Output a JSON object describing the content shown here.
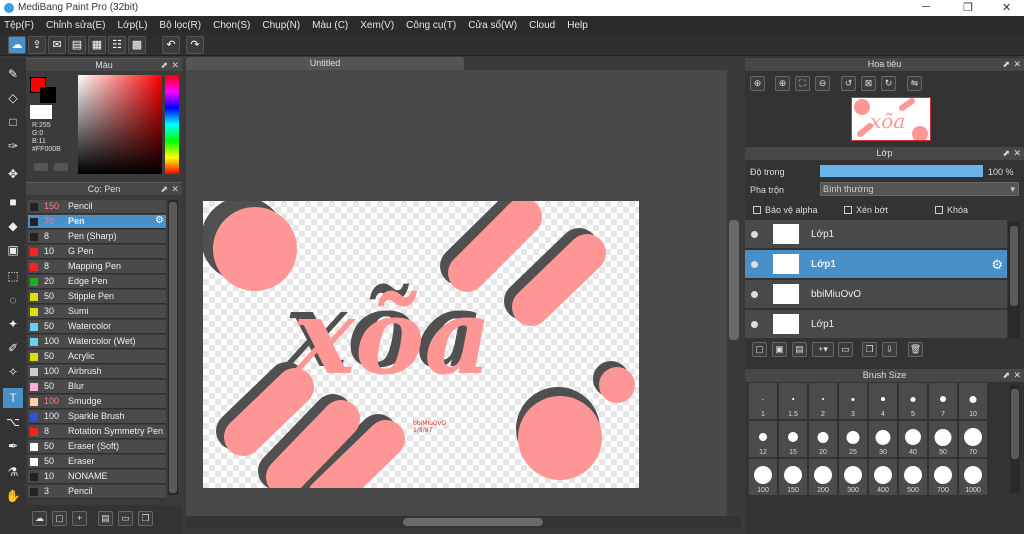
{
  "window": {
    "title": "MediBang Paint Pro (32bit)",
    "min": "─",
    "restore": "❐",
    "close": "✕"
  },
  "menu": [
    "Tệp(F)",
    "Chỉnh sửa(E)",
    "Lớp(L)",
    "Bộ lọc(R)",
    "Chọn(S)",
    "Chụp(N)",
    "Màu (C)",
    "Xem(V)",
    "Công cụ(T)",
    "Cửa sổ(W)",
    "Cloud",
    "Help"
  ],
  "panels": {
    "color": "Màu",
    "brush": "Cọ: Pen",
    "navigator": "Hoa tiêu",
    "layer": "Lớp",
    "brushsize": "Brush Size"
  },
  "color": {
    "r": "R:255",
    "g": "G:0",
    "b": "B:11",
    "hex": "#FF000B",
    "fg": "#ff0000",
    "bg": "#000000"
  },
  "document": {
    "tab": "Untitled"
  },
  "brushes": [
    {
      "size": "150",
      "name": "Pencil",
      "color": "#222222"
    },
    {
      "size": "70",
      "name": "Pen",
      "color": "#222222",
      "selected": true
    },
    {
      "size": "8",
      "name": "Pen (Sharp)",
      "color": "#222222"
    },
    {
      "size": "10",
      "name": "G Pen",
      "color": "#ff2020"
    },
    {
      "size": "8",
      "name": "Mapping Pen",
      "color": "#ff2020"
    },
    {
      "size": "20",
      "name": "Edge Pen",
      "color": "#22aa22"
    },
    {
      "size": "50",
      "name": "Stipple Pen",
      "color": "#e0e000"
    },
    {
      "size": "30",
      "name": "Sumi",
      "color": "#e0e000"
    },
    {
      "size": "50",
      "name": "Watercolor",
      "color": "#6ad0f0"
    },
    {
      "size": "100",
      "name": "Watercolor (Wet)",
      "color": "#6ad0f0"
    },
    {
      "size": "50",
      "name": "Acrylic",
      "color": "#e0e000"
    },
    {
      "size": "100",
      "name": "Airbrush",
      "color": "#cccccc"
    },
    {
      "size": "50",
      "name": "Blur",
      "color": "#ffb0d0"
    },
    {
      "size": "100",
      "name": "Smudge",
      "color": "#ffd0a8"
    },
    {
      "size": "100",
      "name": "Sparkle Brush",
      "color": "#3050e0"
    },
    {
      "size": "8",
      "name": "Rotation Symmetry Pen",
      "color": "#ff2020"
    },
    {
      "size": "50",
      "name": "Eraser (Soft)",
      "color": "#ffffff"
    },
    {
      "size": "50",
      "name": "Eraser",
      "color": "#ffffff"
    },
    {
      "size": "10",
      "name": "NONAME",
      "color": "#222222"
    },
    {
      "size": "3",
      "name": "Pencil",
      "color": "#222222"
    }
  ],
  "layer": {
    "opacity_label": "Độ trong",
    "opacity_value": "100 %",
    "opacity_fraction": 1.0,
    "blend_label": "Pha trộn",
    "blend_value": "Bình thường",
    "protect_alpha": "Bảo vệ alpha",
    "clipping": "Xén bớt",
    "lock": "Khóa"
  },
  "layers": [
    {
      "name": "Lớp1"
    },
    {
      "name": "Lớp1",
      "selected": true
    },
    {
      "name": "bbiMiuOvO"
    },
    {
      "name": "Lớp1"
    }
  ],
  "brush_sizes": [
    "1",
    "1.5",
    "2",
    "3",
    "4",
    "5",
    "7",
    "10",
    "12",
    "15",
    "20",
    "25",
    "30",
    "40",
    "50",
    "70",
    "100",
    "150",
    "200",
    "300",
    "400",
    "500",
    "700",
    "1000"
  ],
  "artwork": {
    "text": "xõa",
    "signature1": "bbiMiuOvO",
    "signature2": "1/8/87"
  }
}
